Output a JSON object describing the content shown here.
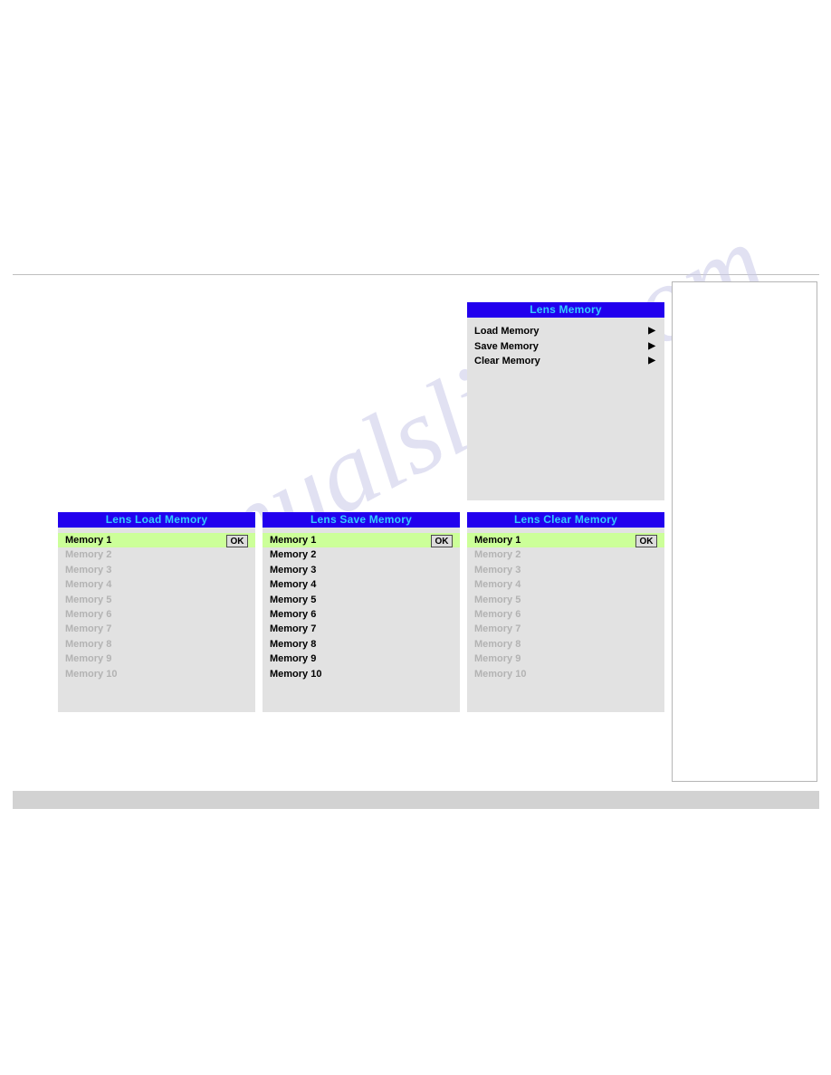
{
  "page": {
    "watermark_text": "manualslive.com"
  },
  "root_menu": {
    "title": "Lens Memory",
    "items": [
      {
        "label": "Load Memory",
        "submenu_icon": "triangle-right-icon"
      },
      {
        "label": "Save Memory",
        "submenu_icon": "triangle-right-icon"
      },
      {
        "label": "Clear Memory",
        "submenu_icon": "triangle-right-icon"
      }
    ]
  },
  "load_panel": {
    "title": "Lens Load Memory",
    "ok_label": "OK",
    "items": [
      {
        "label": "Memory 1",
        "state": "selected"
      },
      {
        "label": "Memory 2",
        "state": "disabled"
      },
      {
        "label": "Memory 3",
        "state": "disabled"
      },
      {
        "label": "Memory 4",
        "state": "disabled"
      },
      {
        "label": "Memory 5",
        "state": "disabled"
      },
      {
        "label": "Memory 6",
        "state": "disabled"
      },
      {
        "label": "Memory 7",
        "state": "disabled"
      },
      {
        "label": "Memory 8",
        "state": "disabled"
      },
      {
        "label": "Memory 9",
        "state": "disabled"
      },
      {
        "label": "Memory 10",
        "state": "disabled"
      }
    ]
  },
  "save_panel": {
    "title": "Lens Save Memory",
    "ok_label": "OK",
    "items": [
      {
        "label": "Memory 1",
        "state": "selected"
      },
      {
        "label": "Memory 2",
        "state": "enabled"
      },
      {
        "label": "Memory 3",
        "state": "enabled"
      },
      {
        "label": "Memory 4",
        "state": "enabled"
      },
      {
        "label": "Memory 5",
        "state": "enabled"
      },
      {
        "label": "Memory 6",
        "state": "enabled"
      },
      {
        "label": "Memory 7",
        "state": "enabled"
      },
      {
        "label": "Memory 8",
        "state": "enabled"
      },
      {
        "label": "Memory 9",
        "state": "enabled"
      },
      {
        "label": "Memory 10",
        "state": "enabled"
      }
    ]
  },
  "clear_panel": {
    "title": "Lens Clear Memory",
    "ok_label": "OK",
    "items": [
      {
        "label": "Memory 1",
        "state": "selected"
      },
      {
        "label": "Memory 2",
        "state": "disabled"
      },
      {
        "label": "Memory 3",
        "state": "disabled"
      },
      {
        "label": "Memory 4",
        "state": "disabled"
      },
      {
        "label": "Memory 5",
        "state": "disabled"
      },
      {
        "label": "Memory 6",
        "state": "disabled"
      },
      {
        "label": "Memory 7",
        "state": "disabled"
      },
      {
        "label": "Memory 8",
        "state": "disabled"
      },
      {
        "label": "Memory 9",
        "state": "disabled"
      },
      {
        "label": "Memory 10",
        "state": "disabled"
      }
    ]
  },
  "colors": {
    "title_bar": "#2200ee",
    "title_text": "#33ccff",
    "panel_background": "#e2e2e2",
    "selected_row": "#ccff99",
    "disabled_text": "#b3b3b3",
    "footer_bar": "#d2d2d2"
  }
}
